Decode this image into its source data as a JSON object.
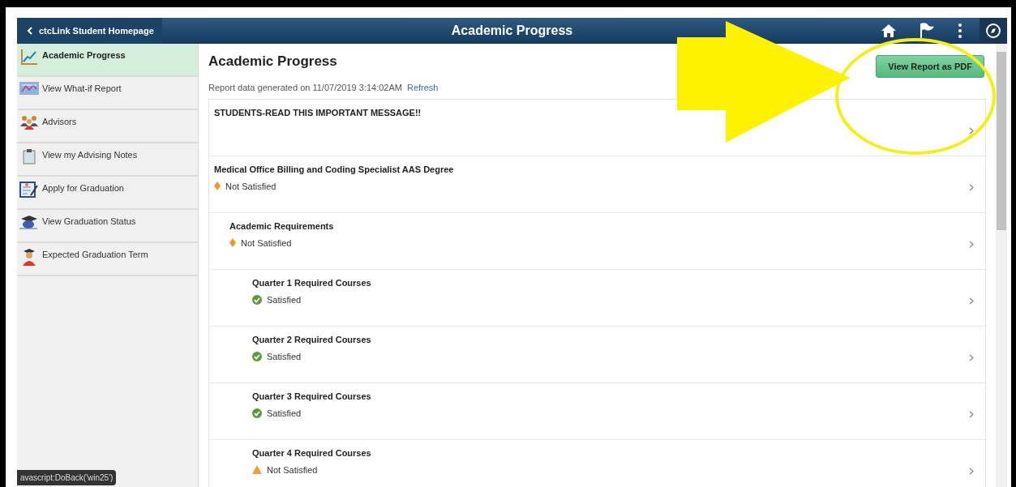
{
  "header": {
    "back_label": "ctcLink Student Homepage",
    "title": "Academic Progress"
  },
  "sidebar": {
    "items": [
      {
        "label": "Academic Progress",
        "selected": true
      },
      {
        "label": "View What-if Report",
        "selected": false
      },
      {
        "label": "Advisors",
        "selected": false
      },
      {
        "label": "View my Advising Notes",
        "selected": false
      },
      {
        "label": "Apply for Graduation",
        "selected": false
      },
      {
        "label": "View Graduation Status",
        "selected": false
      },
      {
        "label": "Expected Graduation Term",
        "selected": false
      }
    ]
  },
  "content": {
    "title": "Academic Progress",
    "generated": "Report data generated on 11/07/2019 3:14:02AM",
    "refresh_link": "Refresh",
    "pdf_button": "View Report as PDF",
    "rows": [
      {
        "title": "STUDENTS-READ THIS IMPORTANT MESSAGE!!"
      },
      {
        "title": "Medical Office Billing and Coding Specialist AAS Degree",
        "status": {
          "kind": "diamond",
          "label": "Not Satisfied"
        },
        "children": [
          {
            "title": "Academic Requirements",
            "status": {
              "kind": "diamond",
              "label": "Not Satisfied"
            },
            "children": [
              {
                "title": "Quarter 1 Required Courses",
                "status": {
                  "kind": "check",
                  "label": "Satisfied"
                }
              },
              {
                "title": "Quarter 2 Required Courses",
                "status": {
                  "kind": "check",
                  "label": "Satisfied"
                }
              },
              {
                "title": "Quarter 3 Required Courses",
                "status": {
                  "kind": "check",
                  "label": "Satisfied"
                }
              },
              {
                "title": "Quarter 4 Required Courses",
                "status": {
                  "kind": "triangle",
                  "label": "Not Satisfied"
                }
              }
            ]
          }
        ]
      }
    ]
  },
  "status_tooltip": "avascript:DoBack('win25')"
}
